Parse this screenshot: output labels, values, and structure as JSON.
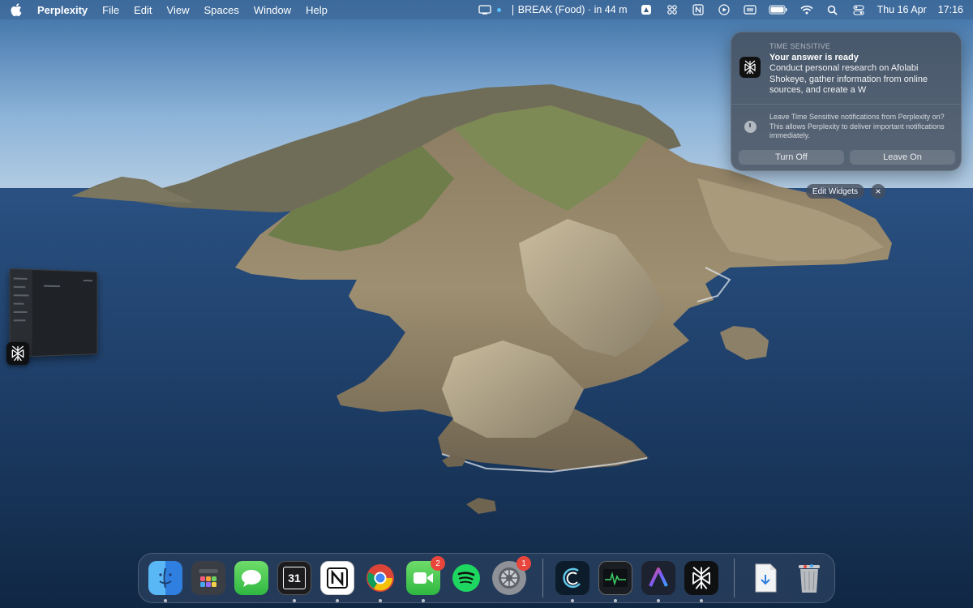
{
  "menubar": {
    "app_name": "Perplexity",
    "menus": [
      "File",
      "Edit",
      "View",
      "Spaces",
      "Window",
      "Help"
    ],
    "event": "BREAK (Food) · in 44 m",
    "date": "Thu 16 Apr",
    "time": "17:16"
  },
  "notification": {
    "kicker": "TIME SENSITIVE",
    "title": "Your answer is ready",
    "body": "Conduct personal research on Afolabi Shokeye, gather information from online sources, and create a W",
    "question": "Leave Time Sensitive notifications from Perplexity on? This allows Perplexity to deliver important notifications immediately.",
    "turn_off_label": "Turn Off",
    "leave_on_label": "Leave On"
  },
  "widgets": {
    "edit_label": "Edit Widgets",
    "close_label": "×"
  },
  "dock": {
    "facetime_badge": "2",
    "settings_badge": "1",
    "apps": [
      "finder",
      "launchpad",
      "messages",
      "calendar",
      "notion",
      "chrome",
      "facetime",
      "spotify",
      "system-settings",
      "app-swoosh",
      "activity-monitor",
      "app-arc",
      "perplexity",
      "downloads",
      "trash"
    ]
  },
  "calendar_icon_day": "31",
  "colors": {
    "accent": "#e8453c",
    "sky": "#7ea9d6",
    "sea": "#1d3d66"
  }
}
